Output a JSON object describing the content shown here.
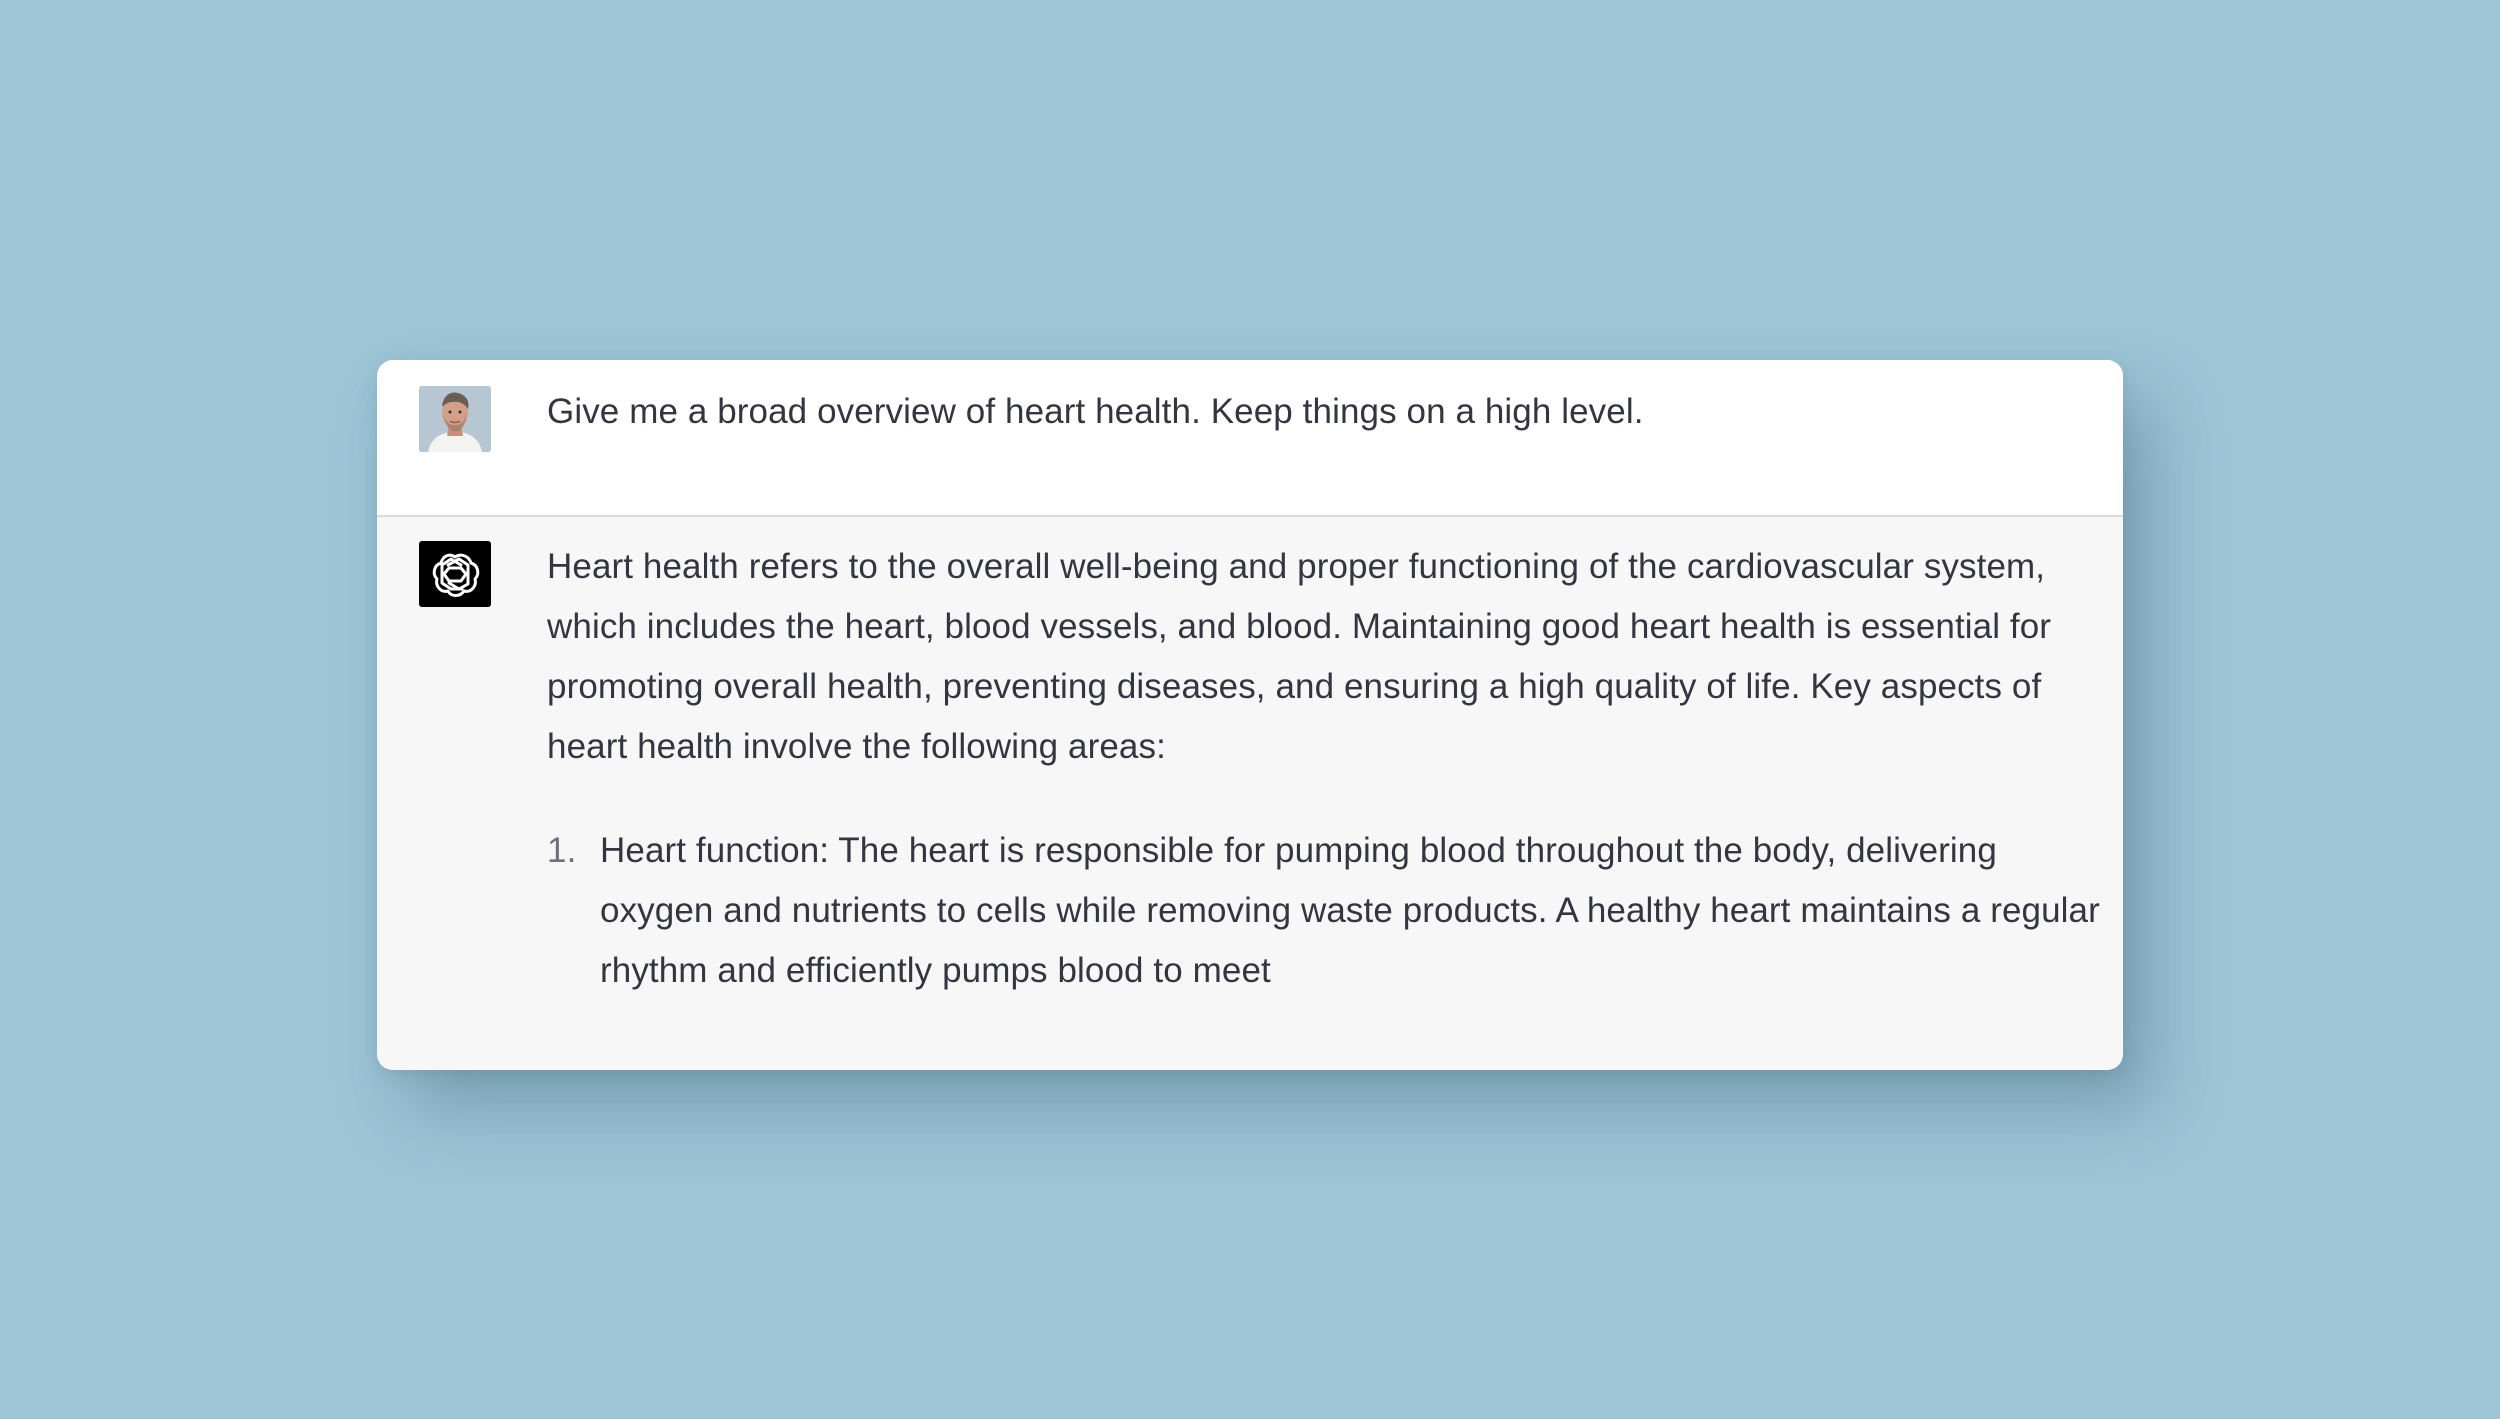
{
  "conversation": {
    "user_message": {
      "avatar": "user-profile-photo",
      "text": "Give me a broad overview of heart health. Keep things on a high level."
    },
    "assistant_message": {
      "avatar": "openai-logo-icon",
      "intro": "Heart health refers to the overall well-being and proper functioning of the cardiovascular system, which includes the heart, blood vessels, and blood. Maintaining good heart health is essential for promoting overall health, preventing diseases, and ensuring a high quality of life. Key aspects of heart health involve the following areas:",
      "list_items": [
        {
          "number": "1.",
          "text": "Heart function: The heart is responsible for pumping blood throughout the body, delivering oxygen and nutrients to cells while removing waste products. A healthy heart maintains a regular rhythm and efficiently pumps blood to meet"
        }
      ]
    }
  },
  "colors": {
    "page_background": "#9dc5d6",
    "user_row_background": "#ffffff",
    "assistant_row_background": "#f7f7f8",
    "text": "#343541",
    "list_number": "#6e6e80",
    "assistant_avatar_background": "#000000"
  }
}
